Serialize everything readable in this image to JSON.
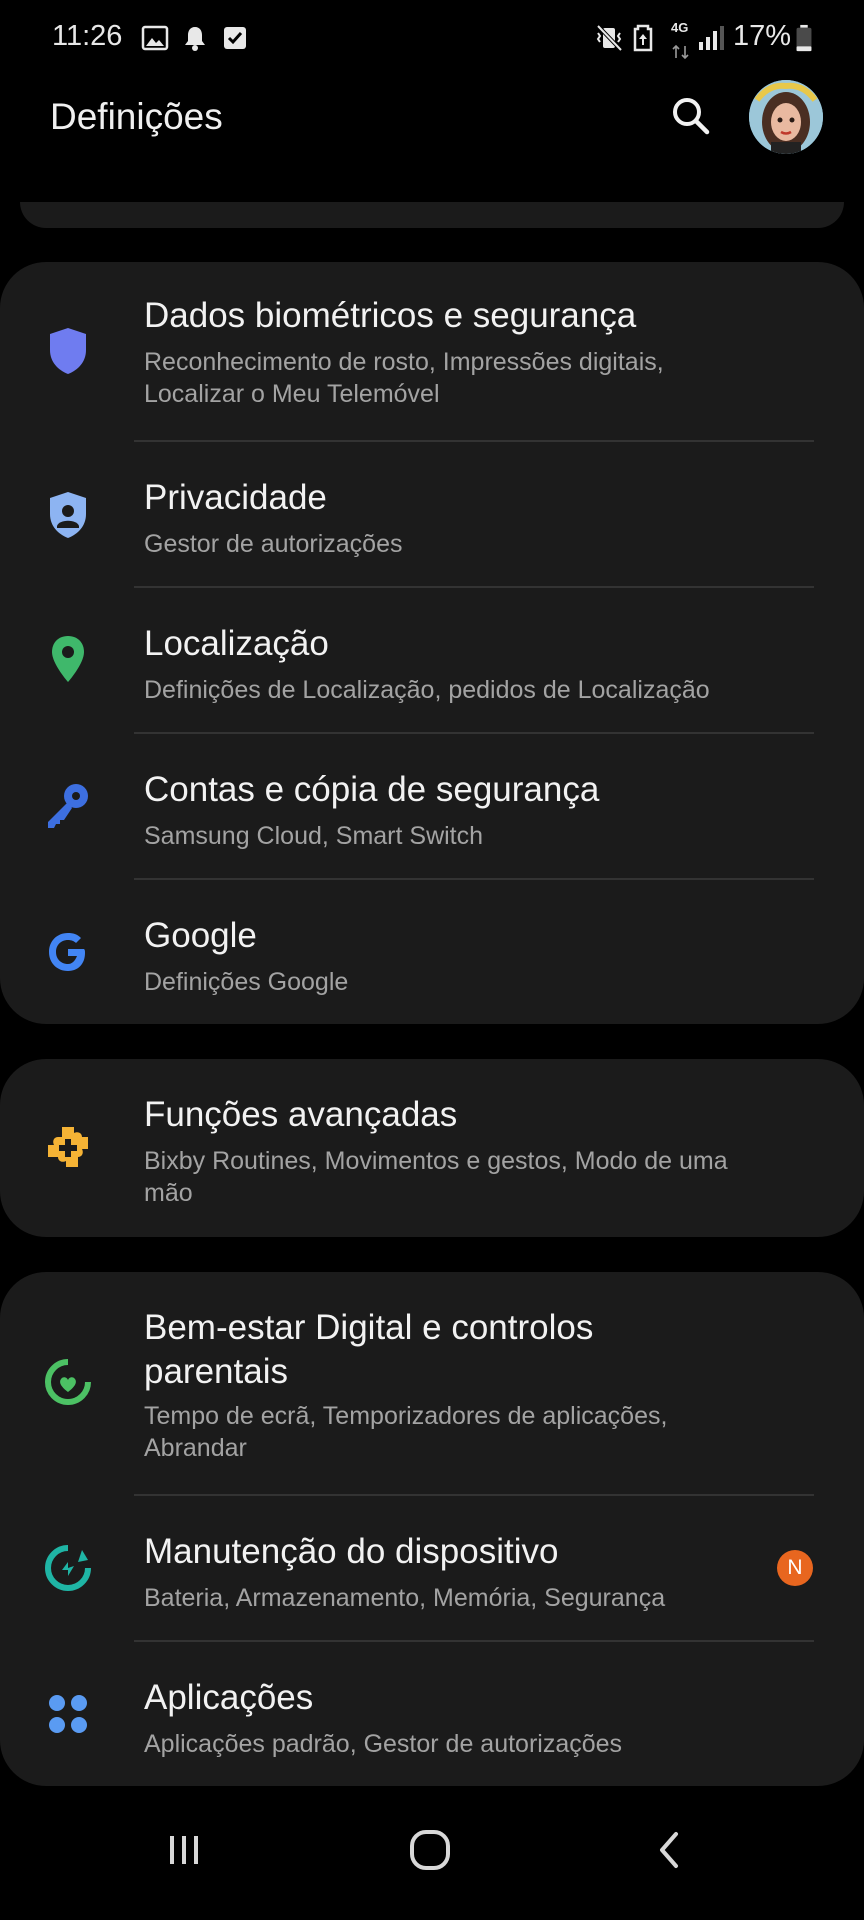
{
  "status_bar": {
    "time": "11:26",
    "battery_text": "17%",
    "network_label": "4G",
    "left_icons": [
      "gallery-icon",
      "notification-bell-icon",
      "check-box-icon"
    ],
    "right_icons": [
      "vibrate-mute-icon",
      "data-saver-icon",
      "network-4g-icon",
      "signal-icon",
      "battery-icon"
    ]
  },
  "header": {
    "title": "Definições",
    "search_icon": "search-icon",
    "avatar_icon": "profile-avatar"
  },
  "cards": [
    {
      "items": [
        {
          "title": "Dados biométricos e segurança",
          "subtitle": "Reconhecimento de rosto, Impressões digitais,",
          "subtitle2": "Localizar o Meu Telemóvel",
          "icon": "shield-icon",
          "icon_color": "#6f7cf0"
        },
        {
          "title": "Privacidade",
          "subtitle": "Gestor de autorizações",
          "icon": "privacy-shield-icon",
          "icon_color": "#8db4f2"
        },
        {
          "title": "Localização",
          "subtitle": "Definições de Localização, pedidos de Localização",
          "icon": "location-pin-icon",
          "icon_color": "#3fb86b"
        },
        {
          "title": "Contas e cópia de segurança",
          "subtitle": "Samsung Cloud, Smart Switch",
          "icon": "key-icon",
          "icon_color": "#3d6fe0"
        },
        {
          "title": "Google",
          "subtitle": "Definições Google",
          "icon": "google-icon",
          "icon_color": "#4285f4"
        }
      ]
    },
    {
      "items": [
        {
          "title": "Funções avançadas",
          "subtitle": "Bixby Routines, Movimentos e gestos, Modo de uma",
          "subtitle2": "mão",
          "icon": "puzzle-plus-icon",
          "icon_color": "#f5b335"
        }
      ]
    },
    {
      "items": [
        {
          "title": "Bem-estar Digital e controlos",
          "title2": "parentais",
          "subtitle": "Tempo de ecrã, Temporizadores de aplicações,",
          "subtitle2": "Abrandar",
          "icon": "wellbeing-icon",
          "icon_color": "#4cc164"
        },
        {
          "title": "Manutenção do dispositivo",
          "subtitle": "Bateria, Armazenamento, Memória, Segurança",
          "icon": "device-care-icon",
          "icon_color": "#1fb5a5",
          "badge": "N",
          "badge_color": "#e8661f"
        },
        {
          "title": "Aplicações",
          "subtitle": "Aplicações padrão, Gestor de autorizações",
          "icon": "apps-grid-icon",
          "icon_color": "#5a9bf2"
        }
      ]
    }
  ],
  "nav_bar": {
    "recents_icon": "recents-icon",
    "home_icon": "home-icon",
    "back_icon": "back-icon"
  }
}
